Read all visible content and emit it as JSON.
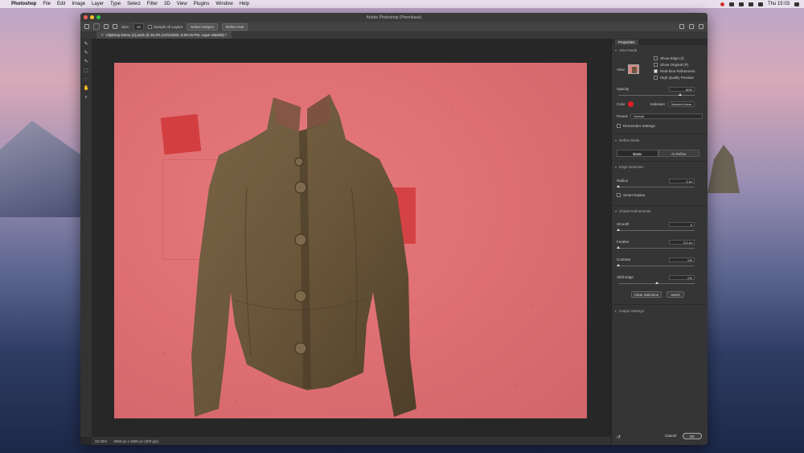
{
  "menubar": {
    "apple": "",
    "app": "Photoshop",
    "items": [
      "File",
      "Edit",
      "Image",
      "Layer",
      "Type",
      "Select",
      "Filter",
      "3D",
      "View",
      "Plugins",
      "Window",
      "Help"
    ],
    "clock": "Thu 15:03"
  },
  "window": {
    "title": "Adobe Photoshop (Prerelease)"
  },
  "options": {
    "size_label": "Size:",
    "size_value": "42",
    "sample_all_layers": "Sample All Layers",
    "select_subject": "Select Subject",
    "refine_hair": "Refine Hair"
  },
  "document": {
    "tab": "ClipDrop Demo (1).psds @ 33.3% (10/1/2020, 5:09:16 PM, Layer Mask/8) *"
  },
  "status": {
    "zoom": "33.33%",
    "dims": "4896 px x 3680 px (300 ppi)"
  },
  "properties": {
    "header": "Properties",
    "view_mode_label": "View Mode",
    "view_label": "View:",
    "show_edge": "Show Edge (J)",
    "show_original": "Show Original (P)",
    "realtime_refinement": "Real-time Refinement",
    "high_quality_preview": "High Quality Preview",
    "opacity_label": "Opacity",
    "opacity_value": "80%",
    "opacity_level": 0.8,
    "color_label": "Color",
    "color_value": "#e01e26",
    "indicates_label": "Indicates:",
    "indicates_value": "Masked Areas",
    "preset_label": "Preset:",
    "preset_value": "Default",
    "remember_settings": "Remember Settings",
    "refine_mode": "Refine Mode",
    "tab_basic": "Basic",
    "tab_ai": "AI Refine",
    "edge_detection": "Edge Detection",
    "radius_label": "Radius",
    "radius_value": "0 px",
    "radius_level": 0.0,
    "smart_radius": "Smart Radius",
    "global_refinements": "Global Refinements",
    "smooth_label": "Smooth",
    "smooth_value": "0",
    "smooth_level": 0.0,
    "feather_label": "Feather",
    "feather_value": "0.0 px",
    "feather_level": 0.0,
    "contrast_label": "Contrast",
    "contrast_value": "0%",
    "contrast_level": 0.0,
    "shift_edge_label": "Shift Edge",
    "shift_edge_value": "0%",
    "shift_edge_level": 0.5,
    "clear_selection": "Clear Selection",
    "invert": "Invert",
    "output_settings": "Output Settings",
    "cancel": "Cancel",
    "ok": "OK"
  }
}
